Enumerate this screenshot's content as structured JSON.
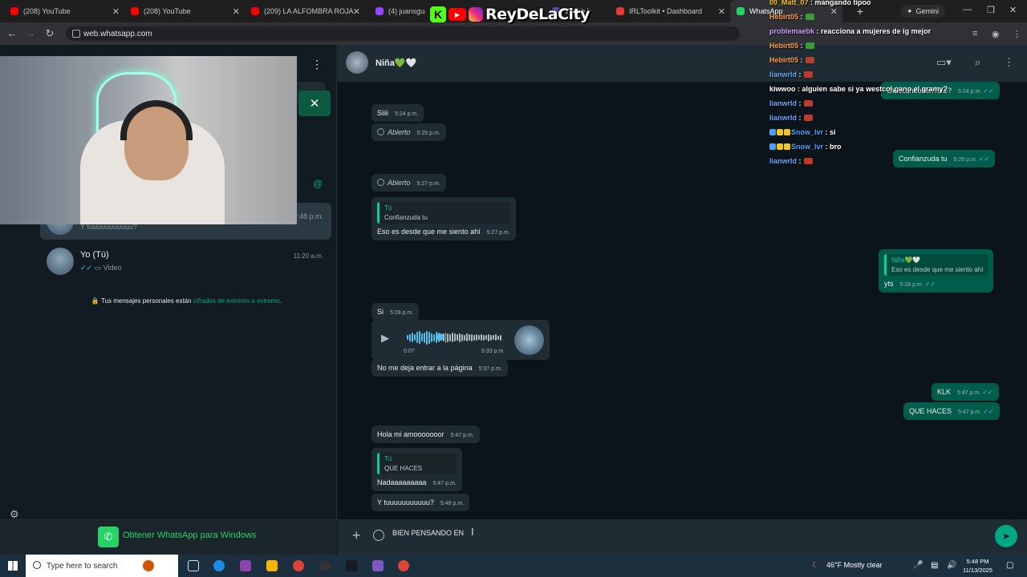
{
  "browser": {
    "tabs": [
      {
        "label": "(208) YouTube",
        "color": "#ff0000"
      },
      {
        "label": "(208) YouTube",
        "color": "#ff0000"
      },
      {
        "label": "(209) LA ALFOMBRA ROJA -",
        "color": "#ff0000"
      },
      {
        "label": "(4) juansguarn",
        "color": "#9146ff"
      },
      {
        "label": "Watch L",
        "color": "#6441a5"
      },
      {
        "label": "IRLToolkit • Dashboard",
        "color": "#e53935"
      },
      {
        "label": "WhatsApp",
        "color": "#25d366"
      }
    ],
    "gemini_label": "Gemini",
    "url": "web.whatsapp.com"
  },
  "overlay": {
    "brand_name": "ReyDeLaCity",
    "kick_letter": "K"
  },
  "sidebar": {
    "active_chat": {
      "preview": "Y tuuuuuuuuuuu?",
      "time": "5:48 p.m."
    },
    "self_chat": {
      "name": "Yo (Tú)",
      "preview": "Video",
      "time": "11:20 a.m."
    },
    "encryption_text": "Tus mensajes personales están",
    "encryption_link": "cifrados de extremo a extremo",
    "encryption_end": ".",
    "get_app": "Obtener WhatsApp para Windows"
  },
  "chat": {
    "contact_name": "Niña💚🤍",
    "messages": [
      {
        "id": "m1",
        "text": "Siiii",
        "time": "5:24 p.m."
      },
      {
        "id": "m2",
        "text": "Abierto",
        "time": "5:25 p.m."
      },
      {
        "id": "m3",
        "text": "Abierto",
        "time": "5:27 p.m."
      },
      {
        "id": "m4",
        "quote_name": "Tú",
        "quote_text": "Confianzuda tu",
        "text": "Eso es desde que me siento ahí",
        "time": "5:27 p.m."
      },
      {
        "id": "m5",
        "text": "Si",
        "time": "5:28 p.m."
      },
      {
        "id": "m6",
        "text": "No me deja entrar a la página",
        "time": "5:37 p.m."
      },
      {
        "id": "m7",
        "text": "Hola mi amooooooor",
        "time": "5:47 p.m."
      },
      {
        "id": "m8",
        "quote_name": "Tú",
        "quote_text": "QUE HACES",
        "text": "Nadaaaaaaaaa",
        "time": "5:47 p.m."
      },
      {
        "id": "m9",
        "text": "Y tuuuuuuuuuuu?",
        "time": "5:48 p.m."
      }
    ],
    "outgoing": [
      {
        "id": "o1",
        "text": "Ok cuando termine?",
        "time": "5:24 p.m."
      },
      {
        "id": "o2",
        "text": "Confianzuda tu",
        "time": "5:26 p.m."
      },
      {
        "id": "o3",
        "quote_name": "Niña💚🤍",
        "quote_text": "Eso es desde que me siento ahí",
        "text": "yts",
        "time": "5:28 p.m."
      },
      {
        "id": "o4",
        "text": "KLK",
        "time": "5:47 p.m."
      },
      {
        "id": "o5",
        "text": "QUE HACES",
        "time": "5:47 p.m."
      }
    ],
    "audio": {
      "current": "0:07",
      "time": "5:33 p.m.",
      "progress": 0.35
    },
    "composer_text": "BIEN PENSANDO EN"
  },
  "stream_chat": [
    {
      "user": "00_Matt_07",
      "color": "#f5c518",
      "text": ": mangando tipoo"
    },
    {
      "user": "Hebirt05",
      "color": "#ff9f43",
      "text": ":",
      "emote": "#3c9a3c"
    },
    {
      "user": "problemaebk",
      "color": "#c9a0ff",
      "text": ": reacciona a mujeres de ig mejor"
    },
    {
      "user": "Hebirt05",
      "color": "#ff9f43",
      "text": ":",
      "emote": "#3c9a3c"
    },
    {
      "user": "Hebirt05",
      "color": "#ff9f43",
      "text": ":",
      "emote": "#b8402e"
    },
    {
      "user": "lianwrld",
      "color": "#6aa7ff",
      "text": ":",
      "emote": "#c0392b"
    },
    {
      "user": "kiwwoo",
      "color": "#ffffff",
      "text": ": alguien sabe si ya westcol gano el gramy?"
    },
    {
      "user": "lianwrld",
      "color": "#6aa7ff",
      "text": ":",
      "emote": "#c0392b"
    },
    {
      "user": "lianwrld",
      "color": "#6aa7ff",
      "text": ":",
      "emote": "#c0392b"
    },
    {
      "user": "Snow_lvr",
      "color": "#4aa3ff",
      "text": ": si",
      "badges": true
    },
    {
      "user": "Snow_lvr",
      "color": "#4aa3ff",
      "text": ": bro",
      "badges": true
    },
    {
      "user": "lianwrld",
      "color": "#6aa7ff",
      "text": ":",
      "emote": "#c0392b"
    }
  ],
  "taskbar": {
    "search_placeholder": "Type here to search",
    "temperature": "46°F",
    "weather": "Mostly clear",
    "time": "5:48 PM",
    "date": "11/13/2025"
  }
}
